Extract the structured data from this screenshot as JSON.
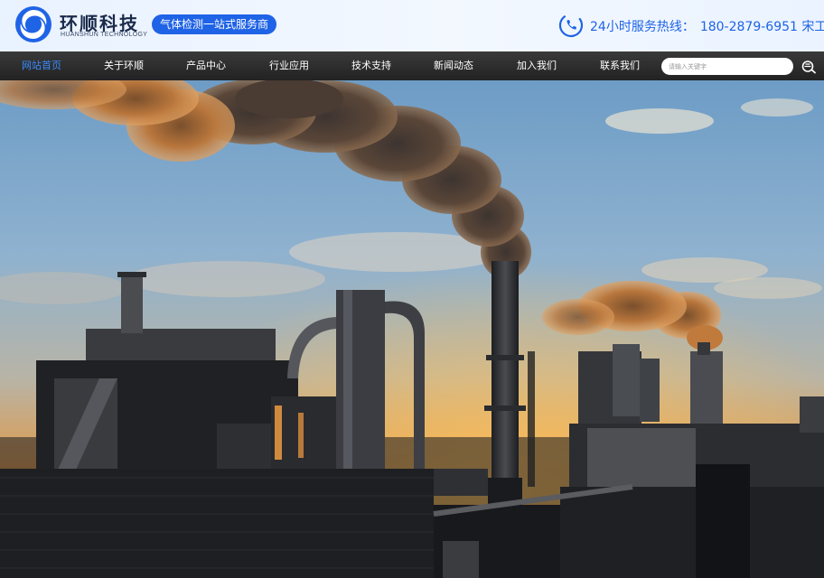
{
  "header": {
    "logo_name": "环顺科技",
    "logo_english": "HUANSHUN TECHNOLOGY",
    "slogan": "气体检测一站式服务商",
    "hotline_label": "24小时服务热线：",
    "hotline_number": "180-2879-6951 宋工",
    "accent_color": "#1f63e6"
  },
  "nav": {
    "items": [
      {
        "label": "网站首页",
        "active": true
      },
      {
        "label": "关于环顺"
      },
      {
        "label": "产品中心"
      },
      {
        "label": "行业应用"
      },
      {
        "label": "技术支持"
      },
      {
        "label": "新闻动态"
      },
      {
        "label": "加入我们"
      },
      {
        "label": "联系我们"
      }
    ],
    "search_placeholder": "请输入关键字",
    "active_color": "#3a8bff"
  },
  "banner": {
    "scene": "industrial-plant-smokestacks-sunset"
  }
}
